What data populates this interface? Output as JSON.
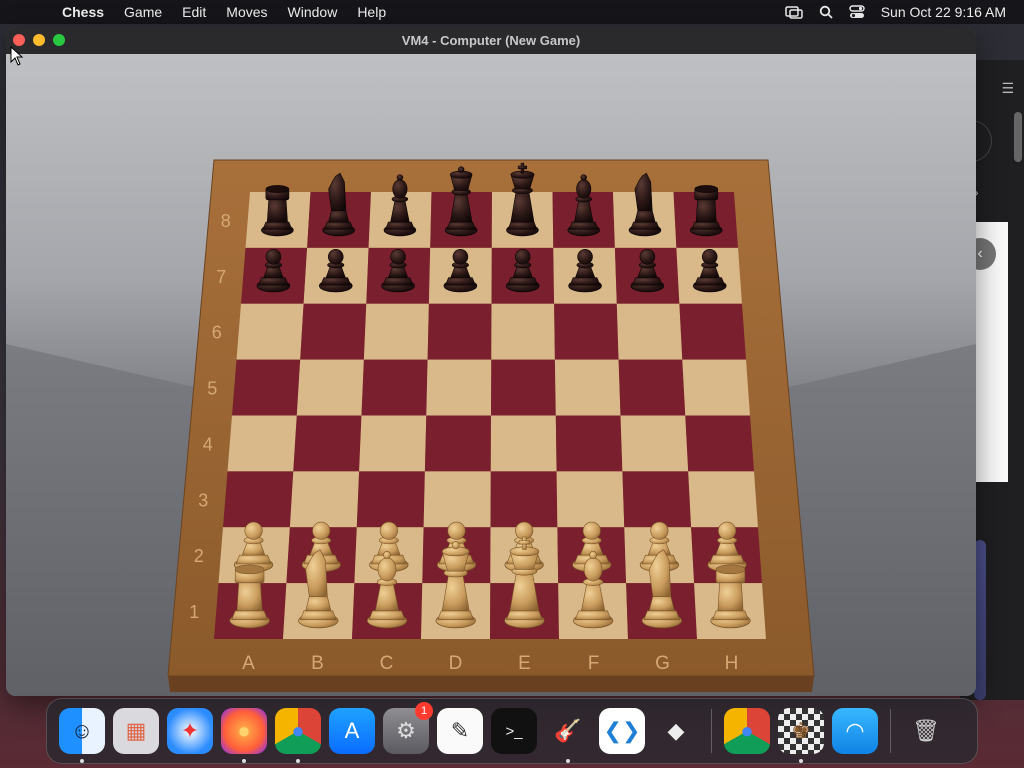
{
  "menubar": {
    "app_name": "Chess",
    "menus": [
      "Game",
      "Edit",
      "Moves",
      "Window",
      "Help"
    ],
    "datetime": "Sun Oct 22  9:16 AM"
  },
  "window": {
    "title": "VM4 - Computer   (New Game)"
  },
  "board": {
    "ranks": [
      "8",
      "7",
      "6",
      "5",
      "4",
      "3",
      "2",
      "1"
    ],
    "files": [
      "A",
      "B",
      "C",
      "D",
      "E",
      "F",
      "G",
      "H"
    ],
    "colors": {
      "light_square": "#d9b98a",
      "dark_square": "#7a1f2e",
      "frame": "#9a6634",
      "white_piece": "#caa063",
      "black_piece": "#2a1a18"
    },
    "position": {
      "8": [
        "r",
        "n",
        "b",
        "q",
        "k",
        "b",
        "n",
        "r"
      ],
      "7": [
        "p",
        "p",
        "p",
        "p",
        "p",
        "p",
        "p",
        "p"
      ],
      "2": [
        "P",
        "P",
        "P",
        "P",
        "P",
        "P",
        "P",
        "P"
      ],
      "1": [
        "R",
        "N",
        "B",
        "Q",
        "K",
        "B",
        "N",
        "R"
      ]
    }
  },
  "dock": {
    "items": [
      {
        "name": "finder",
        "icon": "finder-icon",
        "running": true
      },
      {
        "name": "launchpad",
        "icon": "launchpad-icon",
        "running": false
      },
      {
        "name": "safari",
        "icon": "safari-icon",
        "running": false
      },
      {
        "name": "firefox",
        "icon": "firefox-icon",
        "running": true
      },
      {
        "name": "chrome",
        "icon": "chrome-icon",
        "running": true
      },
      {
        "name": "app-store",
        "icon": "app-store-icon",
        "running": false
      },
      {
        "name": "system-settings",
        "icon": "settings-icon",
        "running": false,
        "badge": "1"
      },
      {
        "name": "textedit",
        "icon": "textedit-icon",
        "running": false
      },
      {
        "name": "terminal",
        "icon": "terminal-icon",
        "running": false
      },
      {
        "name": "garageband",
        "icon": "guitar-icon",
        "running": true
      },
      {
        "name": "vscode",
        "icon": "vscode-icon",
        "running": false
      },
      {
        "name": "roblox",
        "icon": "roblox-icon",
        "running": false
      },
      {
        "name": "chrome-2",
        "icon": "chrome-icon",
        "running": false
      },
      {
        "name": "chess",
        "icon": "chess-icon",
        "running": true
      },
      {
        "name": "wifi-utility",
        "icon": "wifi-icon",
        "running": false
      },
      {
        "name": "trash",
        "icon": "trash-icon",
        "running": false
      }
    ]
  }
}
